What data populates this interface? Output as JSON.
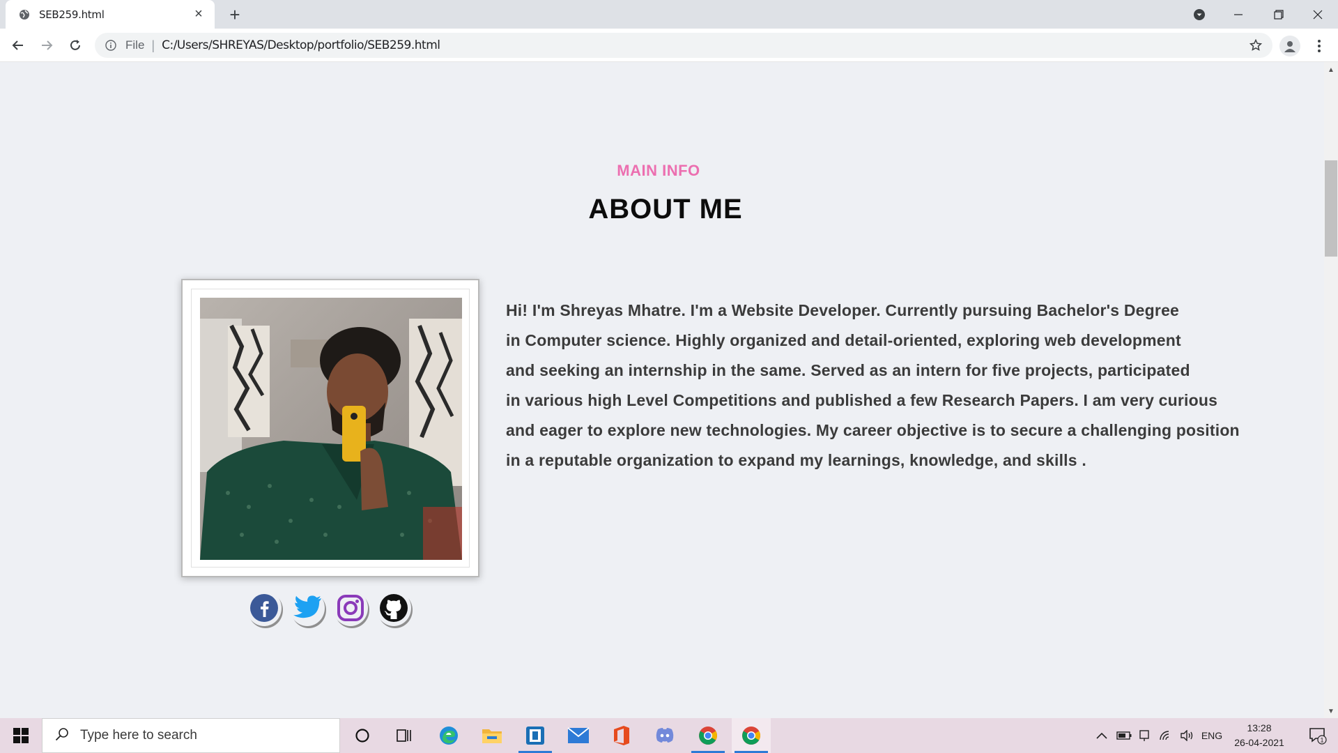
{
  "browser": {
    "tab_title": "SEB259.html",
    "url_scheme_label": "File",
    "url": "C:/Users/SHREYAS/Desktop/portfolio/SEB259.html"
  },
  "page": {
    "subtitle": "MAIN INFO",
    "title": "ABOUT ME",
    "about_lines": [
      "Hi! I'm Shreyas Mhatre. I'm a Website Developer. Currently pursuing Bachelor's Degree",
      "in Computer science. Highly organized and detail-oriented, exploring web development",
      "and seeking an internship in the same. Served as an intern for five projects, participated",
      "in various high Level Competitions and published a few Research Papers. I am very curious",
      "and eager to explore new technologies. My career objective is to secure a challenging position",
      "in a reputable organization to expand my learnings, knowledge, and skills ."
    ],
    "socials": [
      "facebook-icon",
      "twitter-icon",
      "instagram-icon",
      "github-icon"
    ]
  },
  "taskbar": {
    "search_placeholder": "Type here to search",
    "language": "ENG",
    "time": "13:28",
    "date": "26-04-2021",
    "notification_count": "1"
  },
  "colors": {
    "accent_pink": "#ec6fb0",
    "page_bg": "#eef0f4",
    "facebook": "#3b5998",
    "twitter": "#1da1f2",
    "instagram": "#8a3ab9"
  }
}
